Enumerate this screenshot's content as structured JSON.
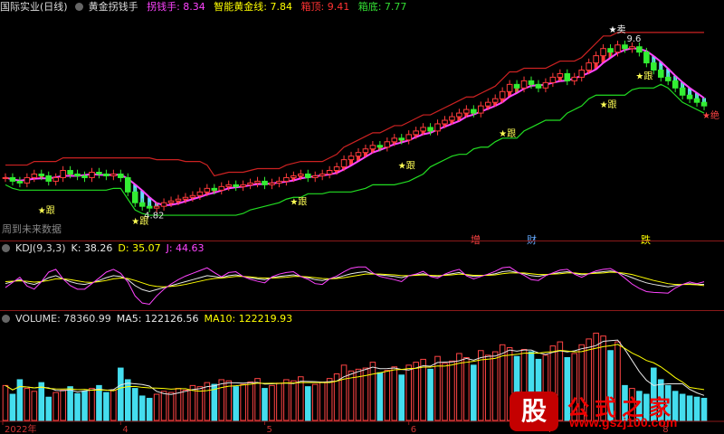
{
  "header": {
    "stock_name": "国际实业(日线)",
    "indicator_name": "黄金拐钱手",
    "lines": [
      {
        "label": "拐钱手",
        "value": "8.34",
        "color": "#ff44ff"
      },
      {
        "label": "智能黄金线",
        "value": "7.84",
        "color": "#ffff00"
      },
      {
        "label": "箱顶",
        "value": "9.41",
        "color": "#ff3333"
      },
      {
        "label": "箱底",
        "value": "7.77",
        "color": "#33dd33"
      }
    ]
  },
  "future_hint": "周到未来数据",
  "events": [
    {
      "label": "增",
      "color": "#ff4444"
    },
    {
      "label": "财",
      "color": "#66aaff"
    },
    {
      "label": "跌",
      "color": "#ffff00"
    }
  ],
  "kdj": {
    "title": "KDJ(9,3,3)",
    "k": "K: 38.26",
    "d": "D: 35.07",
    "j": "J: 44.63",
    "k_color": "#e8e8e8",
    "d_color": "#ffff00",
    "j_color": "#ff44ff"
  },
  "volume": {
    "title": "VOLUME: 78360.99",
    "ma5": "MA5: 122126.56",
    "ma10": "MA10: 122219.93",
    "ma5_color": "#e8e8e8",
    "ma10_color": "#ffff00"
  },
  "annotations": {
    "sell": "★卖",
    "follow": "★跟",
    "high": "9.60",
    "low": "4.82",
    "stop": "★绝"
  },
  "watermark": {
    "badge": "股",
    "title": "公式之家",
    "url": "www.gszj100.com"
  },
  "chart_data": {
    "type": "candlestick",
    "title": "国际实业(日线)",
    "x_axis_labels": [
      "2022年",
      "4",
      "5",
      "6",
      "7",
      "8"
    ],
    "price_high_label": 9.6,
    "price_low_label": 4.82,
    "close": [
      5.7,
      5.6,
      5.55,
      5.7,
      5.8,
      5.75,
      5.6,
      5.7,
      5.9,
      5.8,
      5.75,
      5.7,
      5.85,
      5.8,
      5.75,
      5.8,
      5.7,
      5.3,
      5.0,
      4.9,
      4.85,
      4.9,
      5.0,
      5.05,
      5.1,
      5.15,
      5.2,
      5.3,
      5.4,
      5.35,
      5.45,
      5.5,
      5.45,
      5.5,
      5.55,
      5.6,
      5.5,
      5.55,
      5.6,
      5.7,
      5.75,
      5.8,
      5.7,
      5.75,
      5.8,
      5.9,
      6.0,
      6.2,
      6.3,
      6.4,
      6.5,
      6.6,
      6.55,
      6.7,
      6.8,
      6.75,
      6.9,
      7.0,
      7.1,
      7.0,
      7.2,
      7.3,
      7.4,
      7.5,
      7.6,
      7.5,
      7.7,
      7.8,
      7.9,
      8.1,
      8.3,
      8.2,
      8.4,
      8.3,
      8.2,
      8.35,
      8.5,
      8.6,
      8.4,
      8.5,
      8.7,
      8.9,
      9.1,
      9.3,
      9.2,
      9.4,
      9.3,
      9.35,
      9.2,
      8.9,
      8.7,
      8.5,
      8.4,
      8.2,
      8.0,
      7.9,
      7.8,
      7.7
    ],
    "box_top_label": 9.41,
    "box_bottom_label": 7.77,
    "guai_qian_shou": 8.34,
    "gold_line": 7.84,
    "volume": [
      60,
      45,
      70,
      55,
      50,
      65,
      40,
      48,
      52,
      58,
      46,
      50,
      55,
      60,
      48,
      52,
      90,
      70,
      55,
      42,
      38,
      45,
      50,
      48,
      55,
      52,
      60,
      58,
      65,
      62,
      70,
      68,
      58,
      62,
      66,
      72,
      55,
      60,
      64,
      70,
      68,
      75,
      58,
      62,
      66,
      72,
      80,
      95,
      85,
      88,
      90,
      100,
      82,
      86,
      92,
      78,
      95,
      100,
      105,
      88,
      110,
      98,
      102,
      115,
      108,
      95,
      120,
      112,
      118,
      130,
      125,
      110,
      122,
      118,
      105,
      112,
      128,
      135,
      108,
      115,
      130,
      140,
      150,
      145,
      120,
      135,
      60,
      55,
      50,
      45,
      90,
      70,
      60,
      50,
      45,
      42,
      40,
      38
    ],
    "kdj_k": [
      40,
      45,
      50,
      42,
      38,
      45,
      55,
      60,
      52,
      45,
      40,
      38,
      42,
      48,
      55,
      60,
      58,
      50,
      35,
      25,
      20,
      25,
      30,
      35,
      40,
      45,
      50,
      55,
      60,
      58,
      55,
      60,
      62,
      58,
      55,
      52,
      50,
      55,
      58,
      60,
      62,
      58,
      55,
      50,
      48,
      52,
      55,
      60,
      65,
      68,
      70,
      65,
      62,
      60,
      58,
      55,
      60,
      62,
      65,
      60,
      58,
      62,
      65,
      68,
      62,
      58,
      60,
      62,
      65,
      70,
      72,
      68,
      65,
      60,
      58,
      62,
      65,
      68,
      70,
      66,
      62,
      65,
      68,
      70,
      72,
      68,
      62,
      55,
      48,
      42,
      38,
      35,
      32,
      35,
      38,
      40,
      38,
      38.26
    ],
    "kdj_d": [
      45,
      46,
      47,
      46,
      44,
      45,
      48,
      52,
      52,
      50,
      47,
      44,
      43,
      45,
      48,
      52,
      54,
      53,
      48,
      42,
      36,
      33,
      32,
      33,
      35,
      38,
      42,
      46,
      50,
      53,
      54,
      56,
      58,
      58,
      57,
      55,
      54,
      54,
      55,
      56,
      58,
      58,
      57,
      55,
      53,
      52,
      53,
      55,
      58,
      61,
      64,
      64,
      64,
      63,
      62,
      60,
      60,
      61,
      62,
      61,
      60,
      61,
      62,
      64,
      63,
      61,
      61,
      61,
      62,
      65,
      67,
      67,
      67,
      65,
      63,
      63,
      64,
      65,
      67,
      67,
      65,
      65,
      66,
      67,
      69,
      68,
      66,
      63,
      58,
      53,
      48,
      44,
      40,
      38,
      38,
      38,
      37,
      35.07
    ],
    "kdj_j": [
      30,
      43,
      56,
      34,
      26,
      45,
      69,
      76,
      52,
      35,
      26,
      26,
      40,
      54,
      69,
      76,
      66,
      44,
      9,
      -9,
      -12,
      9,
      26,
      39,
      50,
      59,
      66,
      73,
      80,
      68,
      57,
      68,
      70,
      58,
      51,
      46,
      42,
      57,
      64,
      68,
      70,
      58,
      51,
      40,
      38,
      52,
      59,
      70,
      79,
      82,
      82,
      67,
      58,
      54,
      50,
      45,
      60,
      64,
      71,
      58,
      54,
      64,
      71,
      76,
      60,
      52,
      58,
      64,
      71,
      80,
      82,
      70,
      61,
      50,
      48,
      60,
      67,
      74,
      76,
      64,
      56,
      65,
      72,
      76,
      78,
      68,
      54,
      39,
      28,
      20,
      18,
      17,
      16,
      29,
      38,
      44,
      40,
      44.63
    ]
  }
}
